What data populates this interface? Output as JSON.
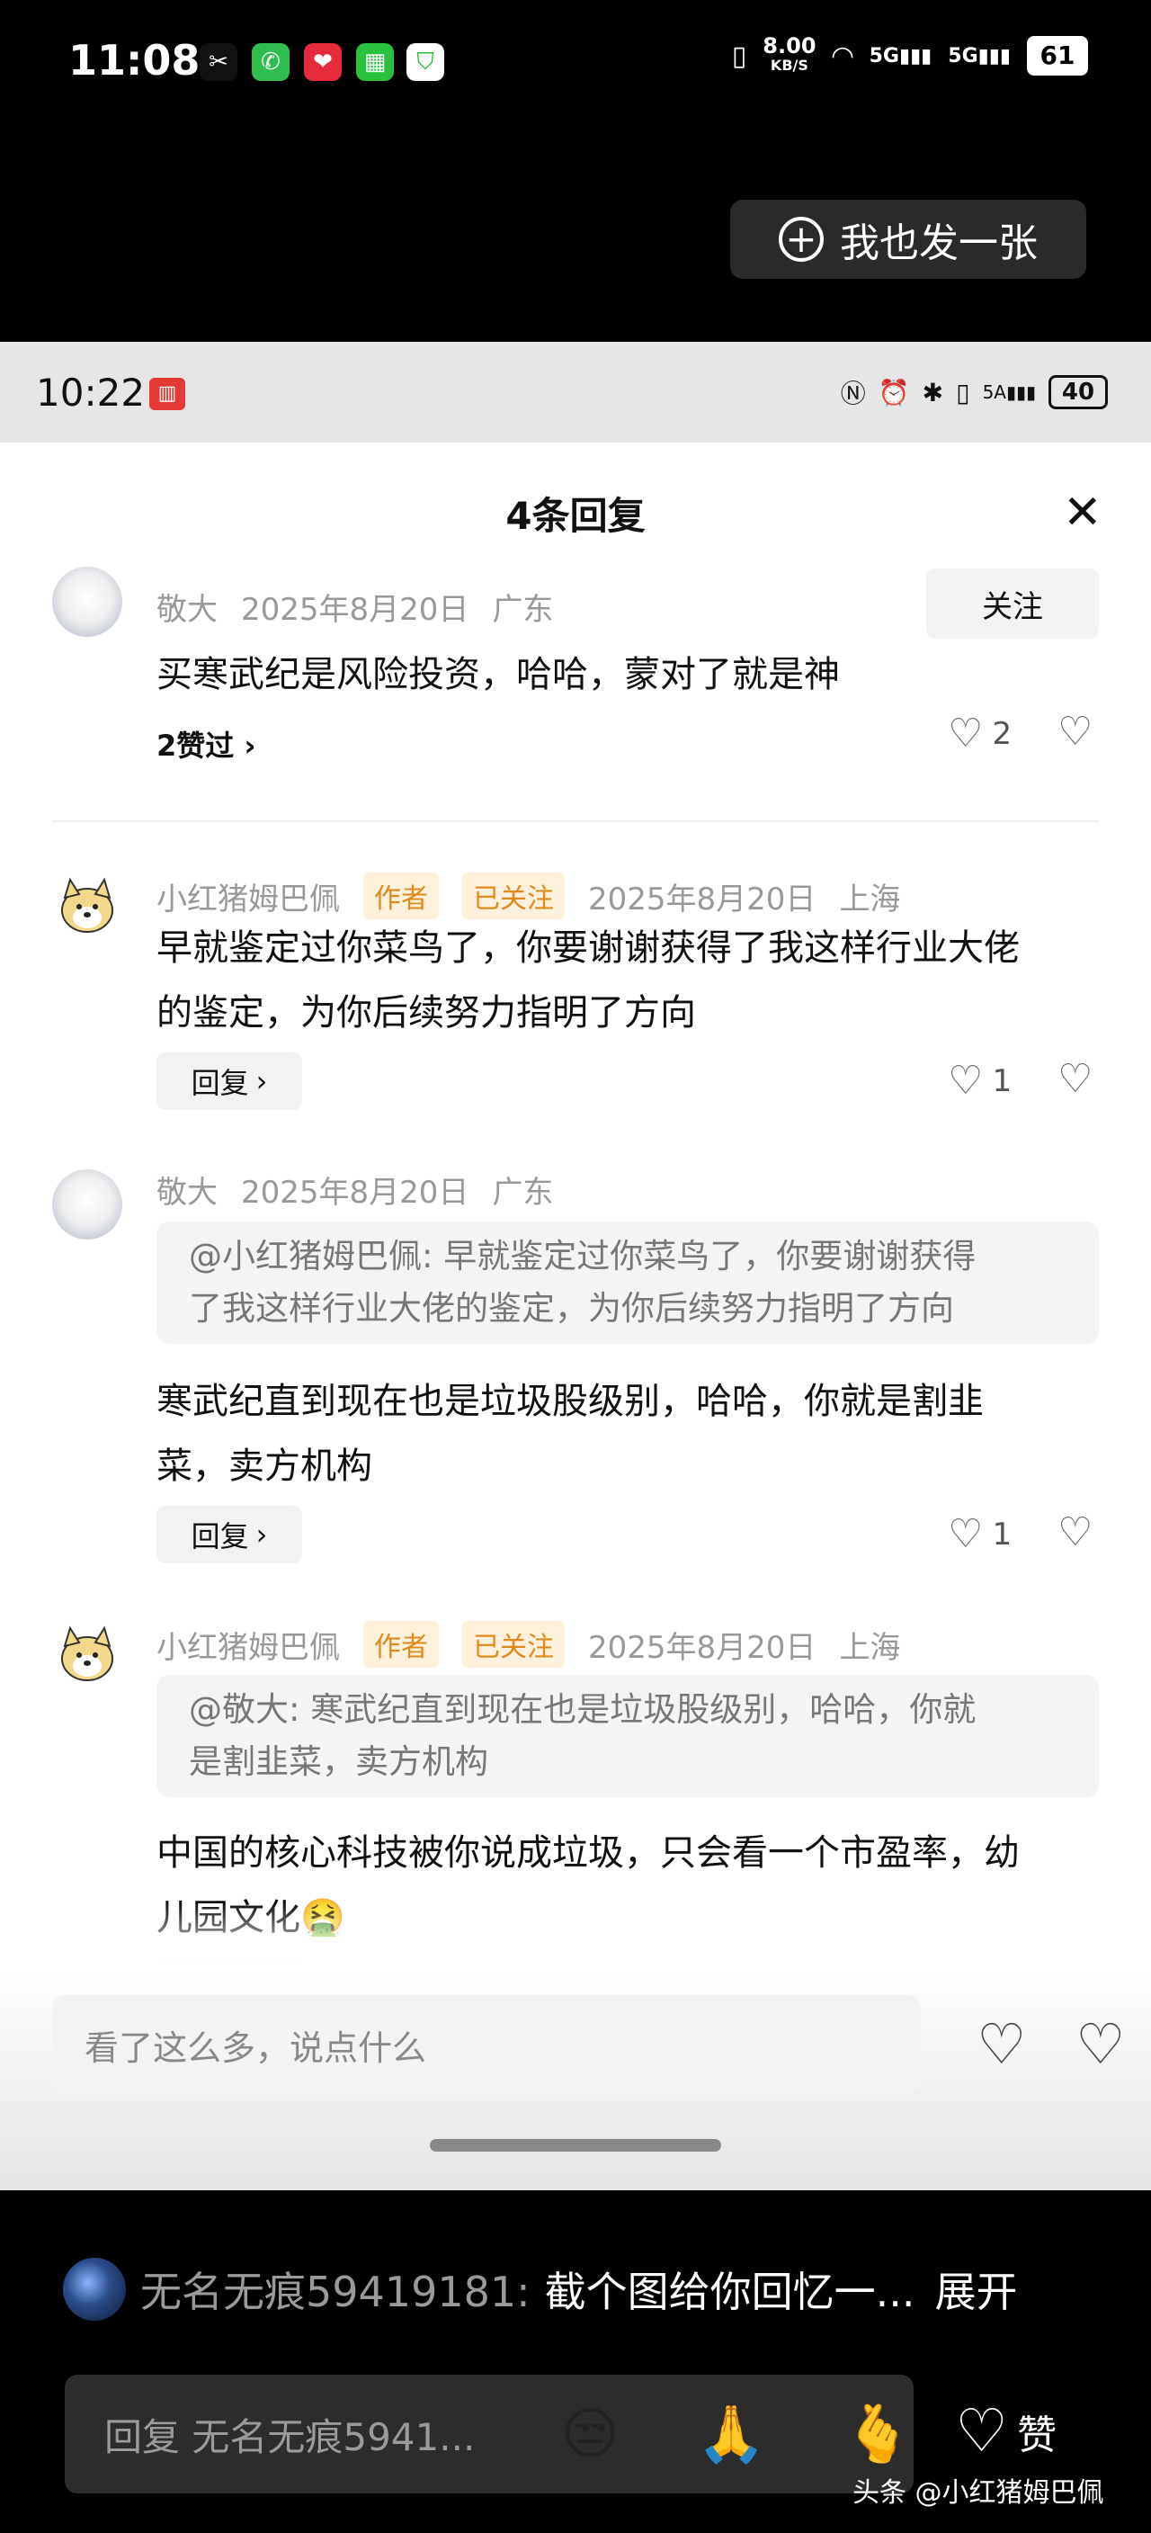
{
  "outer_status": {
    "time": "11:08",
    "net_speed": "8.00",
    "net_unit": "KB/S",
    "sig1": "5G",
    "sig2": "5G",
    "battery": "61"
  },
  "post_button": {
    "label": "我也发一张"
  },
  "inner_status": {
    "time": "10:22",
    "net": "5A",
    "battery": "40"
  },
  "sheet": {
    "title": "4条回复",
    "follow_label": "关注",
    "comments": [
      {
        "author": "敬大",
        "date": "2025年8月20日",
        "location": "广东",
        "text": "买寒武纪是风险投资，哈哈，蒙对了就是神",
        "liked_by": "2赞过",
        "likes": "2"
      },
      {
        "author": "小红猪姆巴佩",
        "tag_author": "作者",
        "tag_follow": "已关注",
        "date": "2025年8月20日",
        "location": "上海",
        "text_line1": "早就鉴定过你菜鸟了，你要谢谢获得了我这样行业大佬",
        "text_line2": "的鉴定，为你后续努力指明了方向",
        "reply": "回复",
        "likes": "1"
      },
      {
        "author": "敬大",
        "date": "2025年8月20日",
        "location": "广东",
        "quote_line1": "@小红猪姆巴佩: 早就鉴定过你菜鸟了，你要谢谢获得",
        "quote_line2": "了我这样行业大佬的鉴定，为你后续努力指明了方向",
        "text_line1": "寒武纪直到现在也是垃圾股级别，哈哈，你就是割韭",
        "text_line2": "菜，卖方机构",
        "reply": "回复",
        "likes": "1"
      },
      {
        "author": "小红猪姆巴佩",
        "tag_author": "作者",
        "tag_follow": "已关注",
        "date": "2025年8月20日",
        "location": "上海",
        "quote_line1": "@敬大: 寒武纪直到现在也是垃圾股级别，哈哈，你就",
        "quote_line2": "是割韭菜，卖方机构",
        "text_line1": "中国的核心科技被你说成垃圾，只会看一个市盈率，幼",
        "text_line2": "儿园文化🤮"
      }
    ],
    "input_placeholder": "看了这么多，说点什么"
  },
  "bottom": {
    "comment_user": "无名无痕59419181:",
    "comment_text": "截个图给你回忆一...",
    "expand": "展开",
    "reply_placeholder": "回复 无名无痕5941...",
    "emojis": [
      "😒",
      "🙏",
      "🫰"
    ],
    "like_label": "赞",
    "watermark": "头条 @小红猪姆巴佩"
  }
}
